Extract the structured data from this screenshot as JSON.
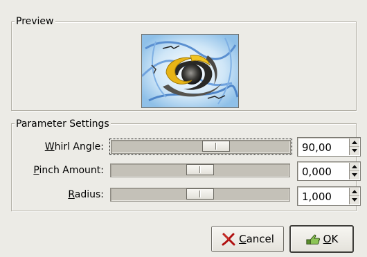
{
  "preview": {
    "title": "Preview",
    "image_alt": "whirled preview"
  },
  "parameters": {
    "title": "Parameter Settings",
    "rows": [
      {
        "mnemonic": "W",
        "label_rest": "hirl Angle:",
        "value": "90,00",
        "slider_fraction": 0.6
      },
      {
        "mnemonic": "P",
        "label_rest": "inch Amount:",
        "value": "0,000",
        "slider_fraction": 0.5
      },
      {
        "mnemonic": "R",
        "label_rest": "adius:",
        "value": "1,000",
        "slider_fraction": 0.5
      }
    ]
  },
  "buttons": {
    "cancel": {
      "mnemonic": "C",
      "label_rest": "ancel",
      "icon": "cancel-x-icon"
    },
    "ok": {
      "mnemonic": "O",
      "label_rest": "K",
      "icon": "ok-hand-icon"
    }
  },
  "colors": {
    "background": "#ecebe6",
    "trough": "#c4c1b8",
    "cancel_icon": "#b01010",
    "ok_icon": "#6aa23a"
  }
}
